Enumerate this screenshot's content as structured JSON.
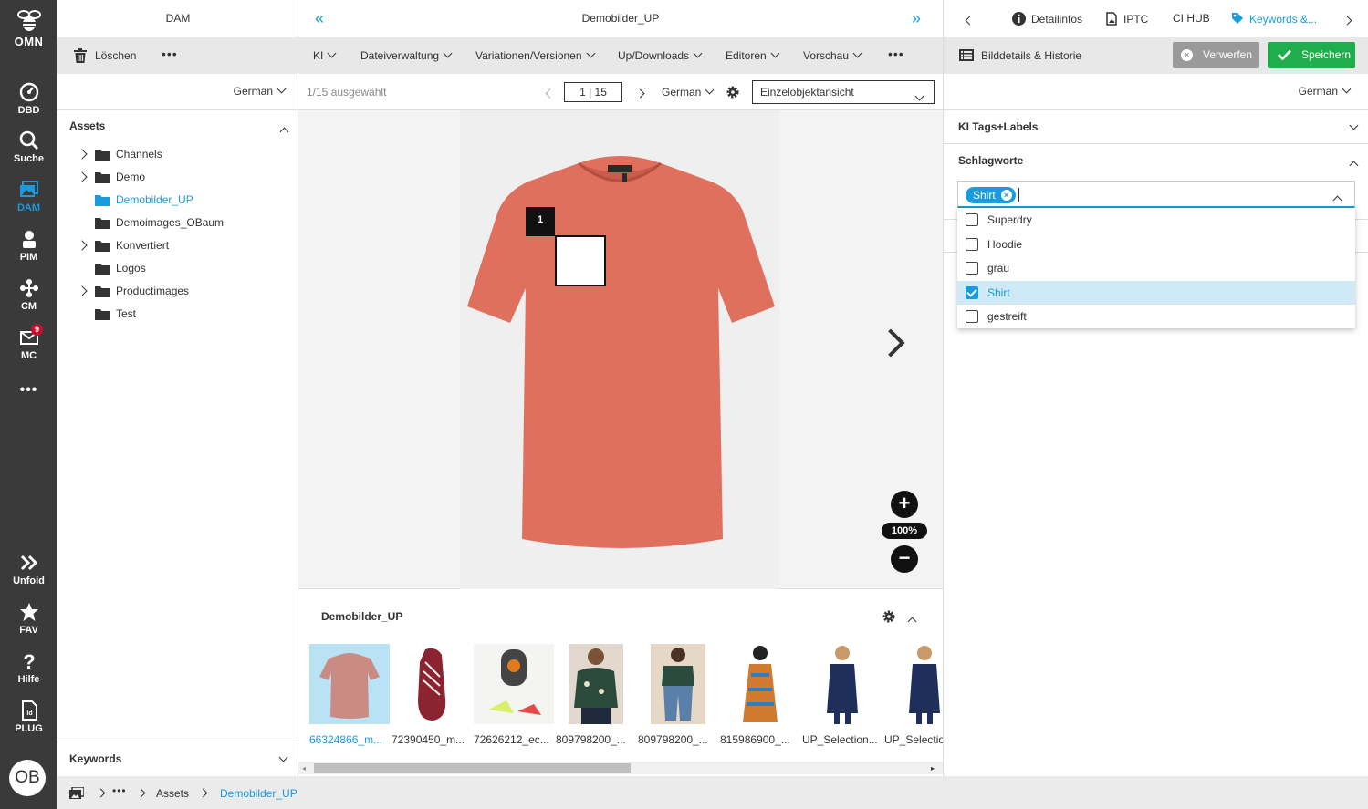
{
  "rail": {
    "logo": "OMN",
    "items": [
      {
        "label": "DBD",
        "icon": "dashboard-icon"
      },
      {
        "label": "Suche",
        "icon": "search-icon"
      },
      {
        "label": "DAM",
        "icon": "images-icon"
      },
      {
        "label": "PIM",
        "icon": "pim-icon"
      },
      {
        "label": "CM",
        "icon": "sitemap-icon"
      },
      {
        "label": "MC",
        "icon": "mail-icon",
        "badge": "9"
      },
      {
        "label": "Unfold",
        "icon": "double-chevron-right-icon"
      },
      {
        "label": "FAV",
        "icon": "star-icon"
      },
      {
        "label": "Hilfe",
        "icon": "question-icon"
      },
      {
        "label": "PLUG",
        "icon": "plugin-file-icon"
      }
    ],
    "more": "•••",
    "avatar": "OB",
    "accent": "#1a9bdc"
  },
  "left_panel": {
    "title": "DAM",
    "delete_label": "Löschen",
    "more": "•••",
    "language": "German",
    "assets_label": "Assets",
    "tree": [
      {
        "label": "Channels",
        "expandable": true,
        "selected": false
      },
      {
        "label": "Demo",
        "expandable": true,
        "selected": false
      },
      {
        "label": "Demobilder_UP",
        "expandable": false,
        "selected": true
      },
      {
        "label": "Demoimages_OBaum",
        "expandable": false,
        "selected": false
      },
      {
        "label": "Konvertiert",
        "expandable": true,
        "selected": false
      },
      {
        "label": "Logos",
        "expandable": false,
        "selected": false
      },
      {
        "label": "Productimages",
        "expandable": true,
        "selected": false
      },
      {
        "label": "Test",
        "expandable": false,
        "selected": false
      }
    ],
    "keywords_label": "Keywords"
  },
  "center": {
    "title": "Demobilder_UP",
    "menus": [
      "KI",
      "Dateiverwaltung",
      "Variationen/Versionen",
      "Up/Downloads",
      "Editoren",
      "Vorschau"
    ],
    "more": "•••",
    "selection_text": "1/15 ausgewählt",
    "pager_value": "1 | 15",
    "language": "German",
    "view_mode": "Einzelobjektansicht",
    "marker_number": "1",
    "zoom_plus": "+",
    "zoom_level": "100%",
    "zoom_minus": "−",
    "strip_title": "Demobilder_UP",
    "thumbnails": [
      {
        "caption": "66324866_m...",
        "selected": true,
        "kind": "shirt"
      },
      {
        "caption": "72390450_m...",
        "selected": false,
        "kind": "shoe"
      },
      {
        "caption": "72626212_ec...",
        "selected": false,
        "kind": "device"
      },
      {
        "caption": "809798200_...",
        "selected": false,
        "kind": "person-floral"
      },
      {
        "caption": "809798200_...",
        "selected": false,
        "kind": "person-jeans"
      },
      {
        "caption": "815986900_...",
        "selected": false,
        "kind": "person-dress"
      },
      {
        "caption": "UP_Selection...",
        "selected": false,
        "kind": "person-navy"
      },
      {
        "caption": "UP_Selectio",
        "selected": false,
        "kind": "person-navy"
      }
    ]
  },
  "right_panel": {
    "tabs": [
      {
        "label": "Detailinfos",
        "icon": "info-icon",
        "active": false
      },
      {
        "label": "IPTC",
        "icon": "file-image-icon",
        "active": false
      },
      {
        "label": "CI HUB",
        "icon": "",
        "active": false
      },
      {
        "label": "Keywords &...",
        "icon": "tag-icon",
        "active": true
      }
    ],
    "history_label": "Bilddetails & Historie",
    "discard_label": "Verwerfen",
    "save_label": "Speichern",
    "language": "German",
    "sections": {
      "ai_tags": "KI Tags+Labels",
      "keywords": "Schlagworte"
    },
    "chip": "Shirt",
    "options": [
      {
        "label": "Superdry",
        "checked": false
      },
      {
        "label": "Hoodie",
        "checked": false
      },
      {
        "label": "grau",
        "checked": false
      },
      {
        "label": "Shirt",
        "checked": true
      },
      {
        "label": "gestreift",
        "checked": false
      }
    ],
    "save_color": "#1fae4b",
    "discard_color": "#9a9a9a"
  },
  "breadcrumb": {
    "more": "•••",
    "items": [
      "Assets",
      "Demobilder_UP"
    ]
  }
}
